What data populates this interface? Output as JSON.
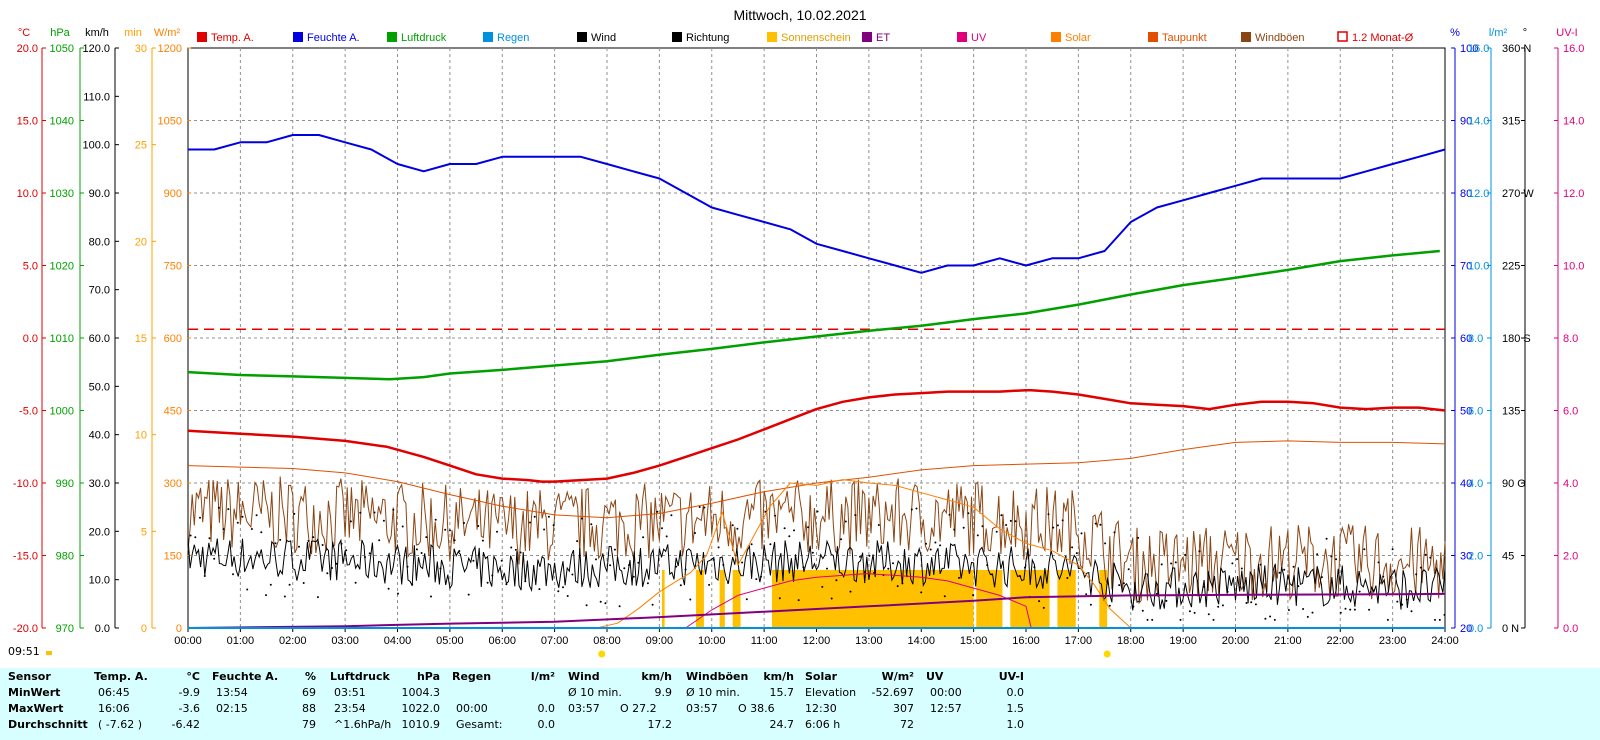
{
  "title": "Mittwoch, 10.02.2021",
  "corner_time": "09:51",
  "colors": {
    "temp": "#e00000",
    "humidity": "#0000e0",
    "pressure": "#00a000",
    "rain": "#0090e0",
    "wind": "#000000",
    "direction": "#000000",
    "sunshine": "#ffc000",
    "et": "#800080",
    "uv": "#e0007a",
    "solar": "#ff8000",
    "dewpoint": "#e05000",
    "gusts": "#8b4513",
    "avg": "#e00000"
  },
  "legend": [
    {
      "label": "Temp. A.",
      "color": "#e00000",
      "kind": "box"
    },
    {
      "label": "Feuchte A.",
      "color": "#0000e0",
      "kind": "box"
    },
    {
      "label": "Luftdruck",
      "color": "#00a000",
      "kind": "box"
    },
    {
      "label": "Regen",
      "color": "#0090e0",
      "kind": "box"
    },
    {
      "label": "Wind",
      "color": "#000000",
      "kind": "box"
    },
    {
      "label": "Richtung",
      "color": "#000000",
      "kind": "box"
    },
    {
      "label": "Sonnenschein",
      "color": "#ffc000",
      "kind": "box"
    },
    {
      "label": "ET",
      "color": "#800080",
      "kind": "box"
    },
    {
      "label": "UV",
      "color": "#e0007a",
      "kind": "box"
    },
    {
      "label": "Solar",
      "color": "#ff8000",
      "kind": "box"
    },
    {
      "label": "Taupunkt",
      "color": "#e05000",
      "kind": "box"
    },
    {
      "label": "Windböen",
      "color": "#8b4513",
      "kind": "box"
    },
    {
      "label": "1.2 Monat-Ø",
      "color": "#e00000",
      "kind": "outline"
    }
  ],
  "chart_data": {
    "type": "line",
    "title": "Mittwoch, 10.02.2021",
    "x_ticks": [
      "00:00",
      "01:00",
      "02:00",
      "03:00",
      "04:00",
      "05:00",
      "06:00",
      "07:00",
      "08:00",
      "09:00",
      "10:00",
      "11:00",
      "12:00",
      "13:00",
      "14:00",
      "15:00",
      "16:00",
      "17:00",
      "18:00",
      "19:00",
      "20:00",
      "21:00",
      "22:00",
      "23:00",
      "24:00"
    ],
    "xlim": [
      0,
      24
    ],
    "axes": {
      "temp": {
        "unit": "°C",
        "ylim": [
          -20,
          20
        ],
        "ticks": [
          "20.0",
          "15.0",
          "10.0",
          "5.0",
          "0.0",
          "-5.0",
          "-10.0",
          "-15.0",
          "-20.0"
        ]
      },
      "pressure": {
        "unit": "hPa",
        "ylim": [
          970,
          1050
        ],
        "ticks": [
          "1050",
          "1040",
          "1030",
          "1020",
          "1010",
          "1000",
          "990",
          "980",
          "970"
        ]
      },
      "wind": {
        "unit": "km/h",
        "ylim": [
          0,
          120
        ],
        "ticks": [
          "120.0",
          "110.0",
          "100.0",
          "90.0",
          "80.0",
          "70.0",
          "60.0",
          "50.0",
          "40.0",
          "30.0",
          "20.0",
          "10.0",
          "0.0"
        ]
      },
      "sunshine": {
        "unit": "min",
        "ylim": [
          0,
          30
        ],
        "ticks": [
          "30",
          "25",
          "20",
          "15",
          "10",
          "5",
          "0"
        ]
      },
      "solar": {
        "unit": "W/m²",
        "ylim": [
          0,
          1200
        ],
        "ticks": [
          "1200",
          "1050",
          "900",
          "750",
          "600",
          "450",
          "300",
          "150",
          "0"
        ]
      },
      "humidity": {
        "unit": "%",
        "ylim": [
          20,
          100
        ],
        "ticks": [
          "100",
          "90",
          "80",
          "70",
          "60",
          "50",
          "40",
          "30",
          "20"
        ]
      },
      "rain": {
        "unit": "l/m²",
        "ylim": [
          0,
          16
        ],
        "ticks": [
          "16.0",
          "14.0",
          "12.0",
          "10.0",
          "8.0",
          "6.0",
          "4.0",
          "2.0",
          "0.0"
        ]
      },
      "direction": {
        "unit": "°",
        "ylim": [
          0,
          360
        ],
        "ticks": [
          "360 N",
          "315",
          "270 W",
          "225",
          "180 S",
          "135",
          "90 O",
          "45",
          "0 N"
        ]
      },
      "uv": {
        "unit": "UV-I",
        "ylim": [
          0,
          16
        ],
        "ticks": [
          "16.0",
          "14.0",
          "12.0",
          "10.0",
          "8.0",
          "6.0",
          "4.0",
          "2.0",
          "0.0"
        ]
      }
    },
    "series": [
      {
        "name": "Temp. A.",
        "axis": "temp",
        "color": "#e00000",
        "x": [
          0,
          1,
          2,
          3,
          3.8,
          4.5,
          5,
          5.5,
          6,
          6.5,
          6.75,
          7,
          7.5,
          8,
          8.5,
          9,
          9.5,
          10,
          10.5,
          11,
          11.5,
          12,
          12.5,
          13,
          13.5,
          14,
          14.5,
          15,
          15.5,
          16,
          16.1,
          16.5,
          17,
          17.5,
          18,
          18.5,
          19,
          19.5,
          20,
          20.5,
          21,
          21.5,
          22,
          22.5,
          23,
          23.5,
          24
        ],
        "y": [
          -6.4,
          -6.6,
          -6.8,
          -7.1,
          -7.5,
          -8.2,
          -8.8,
          -9.4,
          -9.7,
          -9.8,
          -9.9,
          -9.9,
          -9.8,
          -9.7,
          -9.3,
          -8.8,
          -8.2,
          -7.6,
          -7.0,
          -6.3,
          -5.6,
          -4.9,
          -4.4,
          -4.1,
          -3.9,
          -3.8,
          -3.7,
          -3.7,
          -3.7,
          -3.6,
          -3.6,
          -3.7,
          -3.9,
          -4.2,
          -4.5,
          -4.6,
          -4.7,
          -4.9,
          -4.6,
          -4.4,
          -4.4,
          -4.5,
          -4.8,
          -4.9,
          -4.8,
          -4.8,
          -5.0
        ]
      },
      {
        "name": "Feuchte A.",
        "axis": "humidity",
        "color": "#0000e0",
        "x": [
          0,
          0.5,
          1,
          1.5,
          2,
          2.25,
          2.5,
          3,
          3.5,
          4,
          4.5,
          5,
          5.5,
          6,
          6.5,
          7,
          7.5,
          8,
          8.5,
          9,
          9.5,
          10,
          10.5,
          11,
          11.5,
          12,
          12.5,
          13,
          13.5,
          14,
          14.5,
          15,
          15.5,
          16,
          16.5,
          17,
          17.5,
          18,
          18.5,
          19,
          19.5,
          20,
          20.5,
          21,
          21.5,
          22,
          22.5,
          23,
          23.5,
          24
        ],
        "y": [
          86,
          86,
          87,
          87,
          88,
          88,
          88,
          87,
          86,
          84,
          83,
          84,
          84,
          85,
          85,
          85,
          85,
          84,
          83,
          82,
          80,
          78,
          77,
          76,
          75,
          73,
          72,
          71,
          70,
          69,
          70,
          70,
          71,
          70,
          71,
          71,
          72,
          76,
          78,
          79,
          80,
          81,
          82,
          82,
          82,
          82,
          83,
          84,
          85,
          86
        ]
      },
      {
        "name": "Luftdruck",
        "axis": "pressure",
        "color": "#00a000",
        "x": [
          0,
          1,
          2,
          3,
          3.85,
          4.5,
          5,
          6,
          7,
          8,
          9,
          10,
          11,
          12,
          13,
          14,
          15,
          16,
          17,
          18,
          19,
          20,
          21,
          22,
          23,
          23.9
        ],
        "y": [
          1005.3,
          1004.9,
          1004.7,
          1004.5,
          1004.3,
          1004.6,
          1005.1,
          1005.6,
          1006.2,
          1006.8,
          1007.7,
          1008.5,
          1009.4,
          1010.2,
          1011.0,
          1011.7,
          1012.6,
          1013.4,
          1014.6,
          1016.0,
          1017.3,
          1018.3,
          1019.4,
          1020.6,
          1021.4,
          1022.0
        ]
      },
      {
        "name": "Taupunkt",
        "axis": "temp",
        "color": "#e05000",
        "x": [
          0,
          1,
          2,
          3,
          4,
          5,
          6,
          7,
          8,
          9,
          10,
          11,
          12,
          13,
          14,
          15,
          16,
          17,
          18,
          19,
          20,
          21,
          22,
          23,
          24
        ],
        "y": [
          -8.8,
          -8.9,
          -9.0,
          -9.3,
          -9.9,
          -10.8,
          -11.6,
          -12.2,
          -12.4,
          -12.1,
          -11.4,
          -10.6,
          -10.0,
          -9.6,
          -9.1,
          -8.8,
          -8.7,
          -8.6,
          -8.3,
          -7.7,
          -7.2,
          -7.1,
          -7.2,
          -7.2,
          -7.3
        ]
      },
      {
        "name": "Solar",
        "axis": "solar",
        "color": "#ff8000",
        "x": [
          7.8,
          8.2,
          8.6,
          9,
          9.3,
          9.6,
          9.9,
          10.2,
          10.5,
          10.8,
          11.1,
          11.5,
          12,
          12.5,
          13,
          13.5,
          14,
          14.5,
          15,
          15.5,
          16,
          16.5,
          17,
          17.3,
          17.6,
          18
        ],
        "y": [
          0,
          10,
          40,
          75,
          95,
          115,
          150,
          240,
          130,
          190,
          250,
          300,
          295,
          307,
          300,
          295,
          280,
          265,
          250,
          205,
          175,
          160,
          130,
          90,
          40,
          0
        ]
      },
      {
        "name": "UV",
        "axis": "uv",
        "color": "#e0007a",
        "x": [
          9.5,
          10,
          10.5,
          11,
          11.5,
          12,
          12.5,
          12.95,
          13.5,
          14,
          14.5,
          15,
          15.5,
          16,
          16.1
        ],
        "y": [
          0,
          0.5,
          0.9,
          1.1,
          1.3,
          1.4,
          1.45,
          1.5,
          1.45,
          1.4,
          1.3,
          1.1,
          0.9,
          0.6,
          0
        ]
      },
      {
        "name": "ET",
        "axis": "uv",
        "color": "#800080",
        "x": [
          0,
          3,
          5,
          7,
          9,
          11,
          13,
          15,
          16,
          18,
          21,
          23,
          24
        ],
        "y": [
          0,
          0.05,
          0.12,
          0.17,
          0.3,
          0.45,
          0.6,
          0.75,
          0.85,
          0.9,
          0.92,
          0.93,
          0.94
        ]
      },
      {
        "name": "Regen",
        "axis": "rain",
        "color": "#0090e0",
        "x": [
          0,
          24
        ],
        "y": [
          0,
          0
        ]
      }
    ],
    "sunshine_blocks": [
      {
        "start": 9.05,
        "end": 9.1,
        "minutes": 3
      },
      {
        "start": 9.7,
        "end": 9.85,
        "minutes": 3
      },
      {
        "start": 10.15,
        "end": 10.25,
        "minutes": 3
      },
      {
        "start": 10.4,
        "end": 10.55,
        "minutes": 3
      },
      {
        "start": 11.15,
        "end": 15.0,
        "minutes": 3
      },
      {
        "start": 15.05,
        "end": 15.55,
        "minutes": 3
      },
      {
        "start": 15.7,
        "end": 16.45,
        "minutes": 3
      },
      {
        "start": 16.6,
        "end": 16.95,
        "minutes": 3
      },
      {
        "start": 17.4,
        "end": 17.55,
        "minutes": 3
      }
    ],
    "wind_profile": {
      "hours": [
        0,
        3,
        6,
        9,
        12,
        15,
        17,
        18,
        21,
        24
      ],
      "mean": [
        15,
        14,
        12,
        13,
        14,
        13,
        12,
        8,
        9,
        8
      ],
      "gust": [
        24,
        23,
        21,
        22,
        23,
        23,
        21,
        13,
        14,
        13
      ]
    },
    "reference_line": {
      "name": "1.2 Monat-Ø",
      "axis": "temp",
      "value": 0.6
    },
    "sun_markers": [
      {
        "x": 7.9,
        "label": "sunrise"
      },
      {
        "x": 17.55,
        "label": "sunset"
      }
    ]
  },
  "stats": {
    "sensor": {
      "header": "Sensor",
      "rows": [
        "MinWert",
        "MaxWert",
        "Durchschnitt"
      ]
    },
    "temp": {
      "header": "Temp. A.",
      "unit": "°C",
      "time": [
        "06:45",
        "16:06",
        "( -7.62 )"
      ],
      "val": [
        "-9.9",
        "-3.6",
        "-6.42"
      ]
    },
    "humidity": {
      "header": "Feuchte A.",
      "unit": "%",
      "time": [
        "13:54",
        "02:15",
        ""
      ],
      "val": [
        "69",
        "88",
        "79"
      ]
    },
    "pressure": {
      "header": "Luftdruck",
      "unit": "hPa",
      "time": [
        "03:51",
        "23:54",
        "^1.6hPa/h"
      ],
      "val": [
        "1004.3",
        "1022.0",
        "1010.9"
      ]
    },
    "rain": {
      "header": "Regen",
      "unit": "l/m²",
      "time": [
        "",
        "00:00",
        "Gesamt:"
      ],
      "val": [
        "",
        "0.0",
        "0.0"
      ]
    },
    "wind": {
      "header": "Wind",
      "unit": "km/h",
      "time": [
        "Ø 10 min.",
        "03:57",
        ""
      ],
      "mid": [
        "",
        "O 27.2",
        ""
      ],
      "val": [
        "9.9",
        "",
        "17.2"
      ]
    },
    "gust": {
      "header": "Windböen",
      "unit": "km/h",
      "time": [
        "Ø 10 min.",
        "03:57",
        ""
      ],
      "mid": [
        "",
        "O 38.6",
        ""
      ],
      "val": [
        "15.7",
        "",
        "24.7"
      ]
    },
    "solar": {
      "header": "Solar",
      "unit": "W/m²",
      "time": [
        "Elevation",
        "12:30",
        "6:06 h"
      ],
      "val": [
        "-52.697",
        "307",
        "72"
      ]
    },
    "uv": {
      "header": "UV",
      "unit": "UV-I",
      "time": [
        "00:00",
        "12:57",
        ""
      ],
      "val": [
        "0.0",
        "1.5",
        "1.0"
      ]
    }
  }
}
